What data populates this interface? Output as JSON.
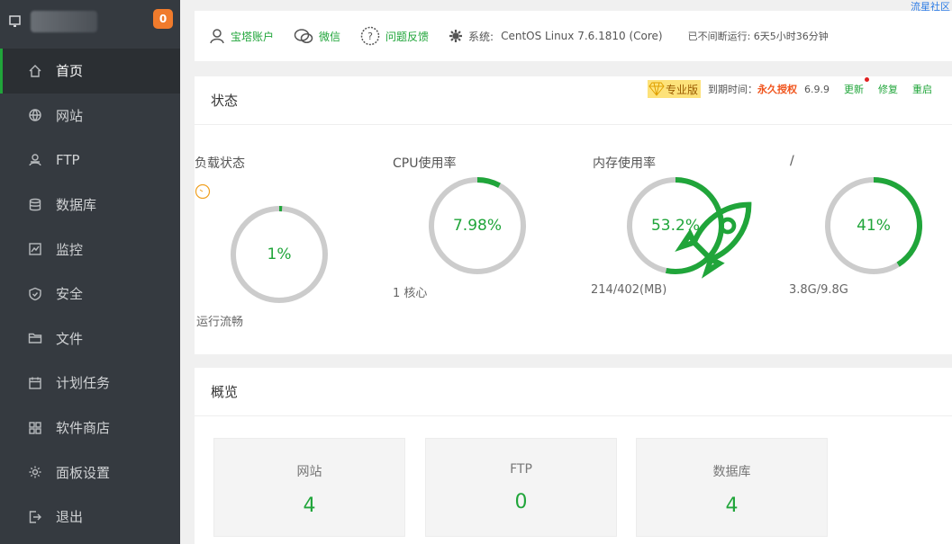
{
  "sidebar": {
    "badge": "0",
    "items": [
      {
        "label": "首页",
        "icon": "home-icon"
      },
      {
        "label": "网站",
        "icon": "globe-icon"
      },
      {
        "label": "FTP",
        "icon": "ftp-icon"
      },
      {
        "label": "数据库",
        "icon": "database-icon"
      },
      {
        "label": "监控",
        "icon": "monitor-icon"
      },
      {
        "label": "安全",
        "icon": "shield-icon"
      },
      {
        "label": "文件",
        "icon": "folder-icon"
      },
      {
        "label": "计划任务",
        "icon": "calendar-icon"
      },
      {
        "label": "软件商店",
        "icon": "apps-icon"
      },
      {
        "label": "面板设置",
        "icon": "gear-icon"
      },
      {
        "label": "退出",
        "icon": "logout-icon"
      }
    ]
  },
  "community_link": "流星社区",
  "topbar": {
    "account": "宝塔账户",
    "wechat": "微信",
    "feedback": "问题反馈",
    "system_label": "系统:",
    "system_value": "CentOS Linux 7.6.1810 (Core)",
    "uptime": "已不间断运行: 6天5小时36分钟"
  },
  "status": {
    "title": "状态",
    "pro_label": "专业版",
    "expire_label": "到期时间：",
    "expire_value": "永久授权",
    "version": "6.9.9",
    "update": "更新",
    "repair": "修复",
    "restart": "重启",
    "gauges": [
      {
        "label": "负载状态",
        "value": "1%",
        "percent": 0.01,
        "sub_bottom": "运行流畅"
      },
      {
        "label": "CPU使用率",
        "value": "7.98%",
        "percent": 0.0798,
        "sub_bottom": "1 核心"
      },
      {
        "label": "内存使用率",
        "value": "53.2%",
        "percent": 0.532,
        "sub_bottom": "214/402(MB)"
      },
      {
        "label": "/",
        "value": "41%",
        "percent": 0.41,
        "sub_bottom": "3.8G/9.8G"
      }
    ]
  },
  "overview": {
    "title": "概览",
    "cards": [
      {
        "name": "网站",
        "count": "4"
      },
      {
        "name": "FTP",
        "count": "0"
      },
      {
        "name": "数据库",
        "count": "4"
      }
    ]
  },
  "colors": {
    "accent": "#20a53a",
    "sidebar_bg": "#353a40",
    "badge": "#f07b2c",
    "ring_bg": "#cccccc"
  }
}
